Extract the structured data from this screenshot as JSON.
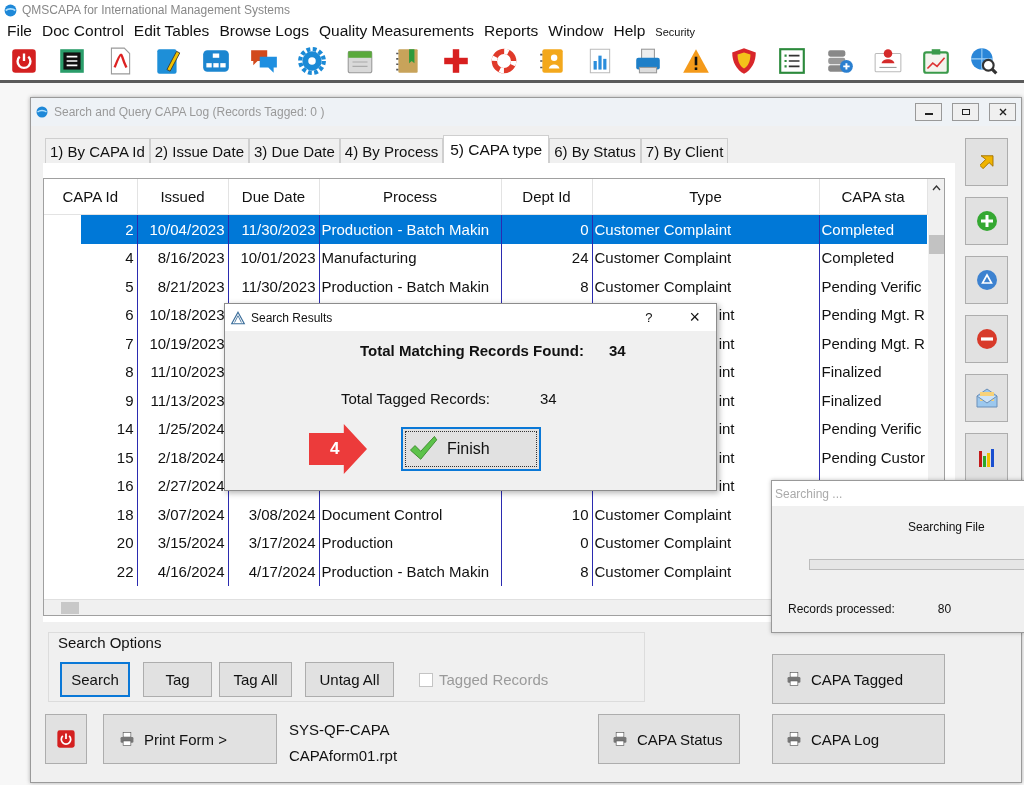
{
  "app": {
    "title": "QMSCAPA for International Management Systems"
  },
  "menu": [
    {
      "label": "File",
      "kind": "main"
    },
    {
      "label": "Doc Control",
      "kind": "main"
    },
    {
      "label": "Edit Tables",
      "kind": "main"
    },
    {
      "label": "Browse Logs",
      "kind": "main"
    },
    {
      "label": "Quality Measurements",
      "kind": "main"
    },
    {
      "label": "Reports",
      "kind": "main"
    },
    {
      "label": "Window",
      "kind": "main"
    },
    {
      "label": "Help",
      "kind": "main"
    },
    {
      "label": "Security",
      "kind": "small"
    }
  ],
  "window": {
    "title": "Search and Query CAPA Log  (Records Tagged:  0 )"
  },
  "tabs": [
    {
      "label": "1) By CAPA Id",
      "selected": false
    },
    {
      "label": "2) Issue Date",
      "selected": false
    },
    {
      "label": "3) Due Date",
      "selected": false
    },
    {
      "label": "4) By Process",
      "selected": false
    },
    {
      "label": "5) CAPA type",
      "selected": true
    },
    {
      "label": "6) By Status",
      "selected": false
    },
    {
      "label": "7) By Client",
      "selected": false
    }
  ],
  "table": {
    "columns": [
      "CAPA Id",
      "Issued",
      "Due Date",
      "Process",
      "Dept Id",
      "Type",
      "CAPA sta"
    ],
    "rows": [
      {
        "id": "2",
        "issued": "10/04/2023",
        "due": "11/30/2023",
        "process": "Production - Batch Makin",
        "dept": "0",
        "type": "Customer Complaint",
        "status": "Completed",
        "selected": true
      },
      {
        "id": "4",
        "issued": "8/16/2023",
        "due": "10/01/2023",
        "process": "Manufacturing",
        "dept": "24",
        "type": "Customer Complaint",
        "status": "Completed",
        "selected": false
      },
      {
        "id": "5",
        "issued": "8/21/2023",
        "due": "11/30/2023",
        "process": "Production - Batch Makin",
        "dept": "8",
        "type": "Customer Complaint",
        "status": "Pending Verific",
        "selected": false
      },
      {
        "id": "6",
        "issued": "10/18/2023",
        "type": "int",
        "status": "Pending Mgt. R",
        "selected": false
      },
      {
        "id": "7",
        "issued": "10/19/2023",
        "type": "int",
        "status": "Pending Mgt. R",
        "selected": false
      },
      {
        "id": "8",
        "issued": "11/10/2023",
        "type": "int",
        "status": "Finalized",
        "selected": false
      },
      {
        "id": "9",
        "issued": "11/13/2023",
        "type": "int",
        "status": "Finalized",
        "selected": false
      },
      {
        "id": "14",
        "issued": "1/25/2024",
        "type": "int",
        "status": "Pending Verific",
        "selected": false
      },
      {
        "id": "15",
        "issued": "2/18/2024",
        "type": "int",
        "status": "Pending Custor",
        "selected": false
      },
      {
        "id": "16",
        "issued": "2/27/2024",
        "type": "int",
        "selected": false
      },
      {
        "id": "18",
        "issued": "3/07/2024",
        "due": "3/08/2024",
        "process": "Document Control",
        "dept": "10",
        "type": "Customer Complaint",
        "selected": false
      },
      {
        "id": "20",
        "issued": "3/15/2024",
        "due": "3/17/2024",
        "process": "Production",
        "dept": "0",
        "type": "Customer Complaint",
        "selected": false
      },
      {
        "id": "22",
        "issued": "4/16/2024",
        "due": "4/17/2024",
        "process": "Production - Batch Makin",
        "dept": "8",
        "type": "Customer Complaint",
        "selected": false
      }
    ]
  },
  "search_options": {
    "title": "Search Options",
    "buttons": [
      {
        "label": "Search",
        "focused": true
      },
      {
        "label": "Tag",
        "focused": false
      },
      {
        "label": "Tag All",
        "focused": false
      },
      {
        "label": "Untag All",
        "focused": false
      }
    ],
    "checkbox": {
      "label": "Tagged Records",
      "checked": false,
      "disabled": true
    }
  },
  "buttons": {
    "capa_tagged": "CAPA Tagged",
    "print_form": "Print Form >",
    "capa_status": "CAPA Status",
    "capa_log": "CAPA Log"
  },
  "report": {
    "form_id": "SYS-QF-CAPA",
    "file": "CAPAform01.rpt"
  },
  "search_results": {
    "title": "Search Results",
    "help": "?",
    "close": "×",
    "matching_label": "Total Matching Records Found:",
    "matching_value": "34",
    "tagged_label": "Total Tagged Records:",
    "tagged_value": "34",
    "button": "Finish"
  },
  "callout": {
    "label": "4"
  },
  "searching": {
    "title": "Searching ...",
    "message": "Searching File",
    "level": 0,
    "processed_label": "Records processed:",
    "processed_value": "80"
  }
}
